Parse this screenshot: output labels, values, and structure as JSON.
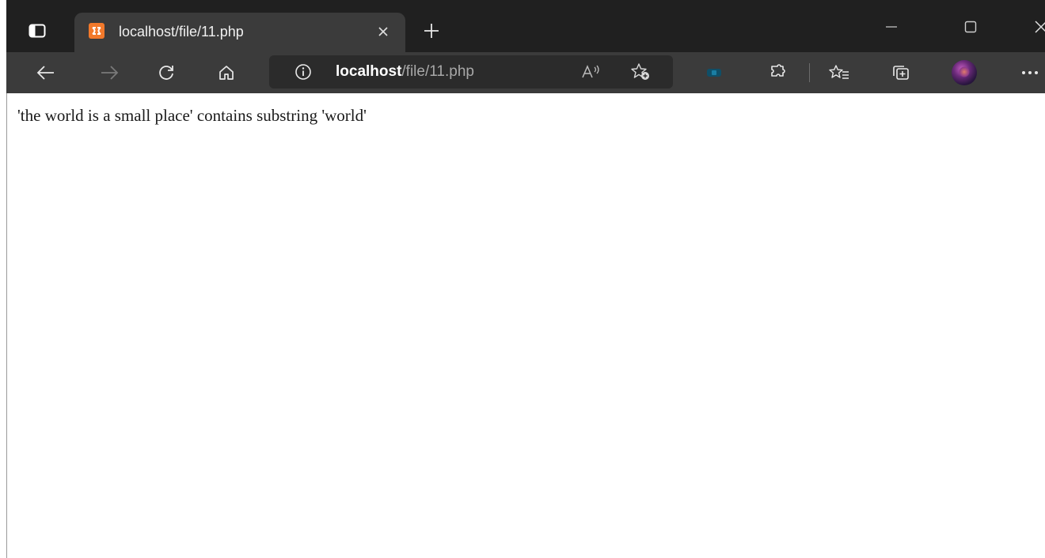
{
  "window": {
    "tab_title": "localhost/file/11.php"
  },
  "address_bar": {
    "url_host": "localhost",
    "url_path": "/file/11.php"
  },
  "page": {
    "message": "'the world is a small place' contains substring 'world'"
  },
  "colors": {
    "tabstrip_bg": "#202020",
    "toolbar_bg": "#3b3b3b",
    "favicon_accent": "#f2792b"
  },
  "icons": {
    "tab_actions": "tab-actions-icon",
    "favicon": "xampp-favicon-icon",
    "tab_close": "close-icon",
    "new_tab": "plus-icon",
    "minimize": "minimize-icon",
    "maximize": "maximize-icon",
    "window_close": "close-icon",
    "back": "arrow-left-icon",
    "forward": "arrow-right-icon",
    "refresh": "refresh-icon",
    "home": "home-icon",
    "site_info": "info-icon",
    "read_aloud": "read-aloud-icon",
    "add_favorite": "star-add-icon",
    "extension": "extension-icon",
    "extensions": "puzzle-icon",
    "favorites": "favorites-list-icon",
    "collections": "collections-icon",
    "profile": "avatar",
    "more": "ellipsis-icon"
  }
}
